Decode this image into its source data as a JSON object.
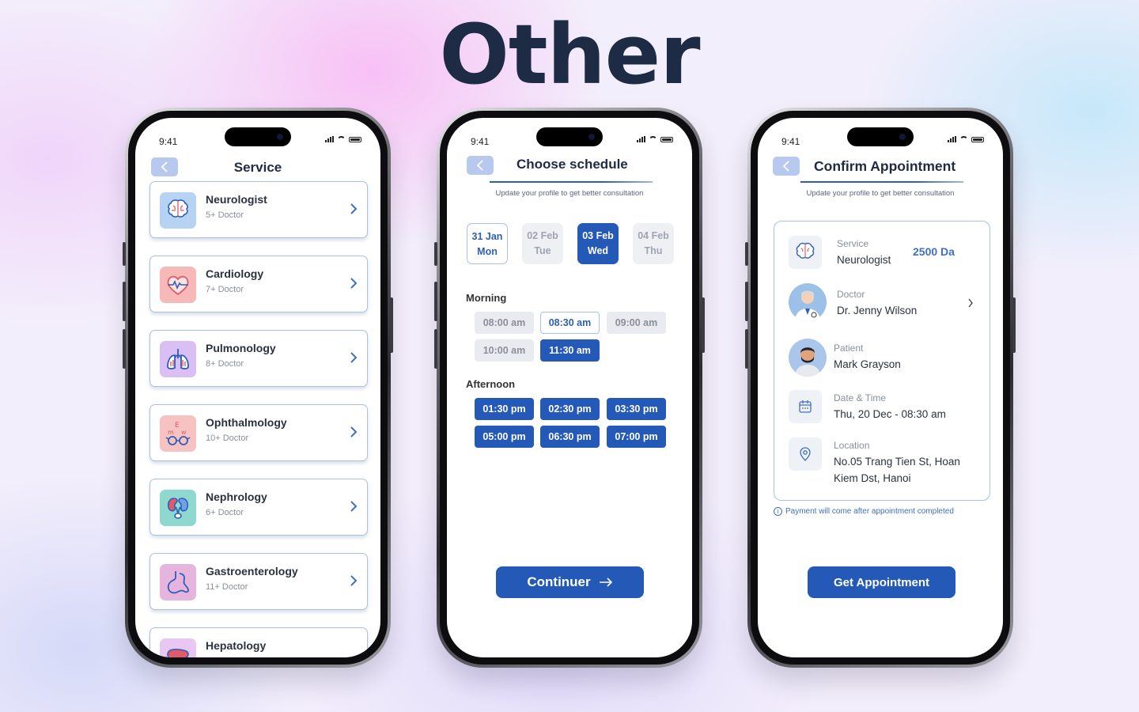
{
  "hero": {
    "title": "Other"
  },
  "status": {
    "time": "9:41"
  },
  "services_screen": {
    "title": "Service",
    "items": [
      {
        "name": "Neurologist",
        "sub": "5+ Doctor",
        "icon": "brain-icon",
        "color": "#b6d3f4"
      },
      {
        "name": "Cardiology",
        "sub": "7+ Doctor",
        "icon": "heart-icon",
        "color": "#f6b9b7"
      },
      {
        "name": "Pulmonology",
        "sub": "8+ Doctor",
        "icon": "lungs-icon",
        "color": "#d9bff3"
      },
      {
        "name": "Ophthalmology",
        "sub": "10+ Doctor",
        "icon": "eye-chart-icon",
        "color": "#f7c2c2"
      },
      {
        "name": "Nephrology",
        "sub": "6+ Doctor",
        "icon": "kidney-icon",
        "color": "#8fd8cf"
      },
      {
        "name": "Gastroenterology",
        "sub": "11+ Doctor",
        "icon": "stomach-icon",
        "color": "#e6b5de"
      },
      {
        "name": "Hepatology",
        "sub": "",
        "icon": "liver-icon",
        "color": "#e8c7f2"
      }
    ]
  },
  "schedule_screen": {
    "title": "Choose schedule",
    "subtitle": "Update your profile to get better consultation",
    "dates": [
      {
        "date": "31 Jan",
        "day": "Mon",
        "state": "outlined"
      },
      {
        "date": "02 Feb",
        "day": "Tue",
        "state": "muted"
      },
      {
        "date": "03 Feb",
        "day": "Wed",
        "state": "active"
      },
      {
        "date": "04 Feb",
        "day": "Thu",
        "state": "muted"
      }
    ],
    "morning_label": "Morning",
    "morning_slots": [
      {
        "time": "08:00 am",
        "state": "muted"
      },
      {
        "time": "08:30 am",
        "state": "outlined"
      },
      {
        "time": "09:00 am",
        "state": "muted"
      },
      {
        "time": "10:00 am",
        "state": "muted"
      },
      {
        "time": "11:30 am",
        "state": "active"
      }
    ],
    "afternoon_label": "Afternoon",
    "afternoon_slots": [
      {
        "time": "01:30 pm",
        "state": "active"
      },
      {
        "time": "02:30 pm",
        "state": "active"
      },
      {
        "time": "03:30 pm",
        "state": "active"
      },
      {
        "time": "05:00 pm",
        "state": "active"
      },
      {
        "time": "06:30 pm",
        "state": "active"
      },
      {
        "time": "07:00 pm",
        "state": "active"
      }
    ],
    "continue_label": "Continuer"
  },
  "confirm_screen": {
    "title": "Confirm Appointment",
    "subtitle": "Update your profile to get better consultation",
    "service_label": "Service",
    "service_value": "Neurologist",
    "price": "2500 Da",
    "doctor_label": "Doctor",
    "doctor_value": "Dr. Jenny Wilson",
    "patient_label": "Patient",
    "patient_value": "Mark Grayson",
    "datetime_label": "Date & Time",
    "datetime_value": "Thu, 20 Dec -  08:30 am",
    "location_label": "Location",
    "location_line1": "No.05 Trang Tien St, Hoan",
    "location_line2": "Kiem Dst, Hanoi",
    "note": "Payment will come after appointment completed",
    "cta": "Get Appointment"
  },
  "colors": {
    "primary": "#2559b8",
    "accent_light": "#a9c1e8",
    "title": "#1d2b45"
  }
}
